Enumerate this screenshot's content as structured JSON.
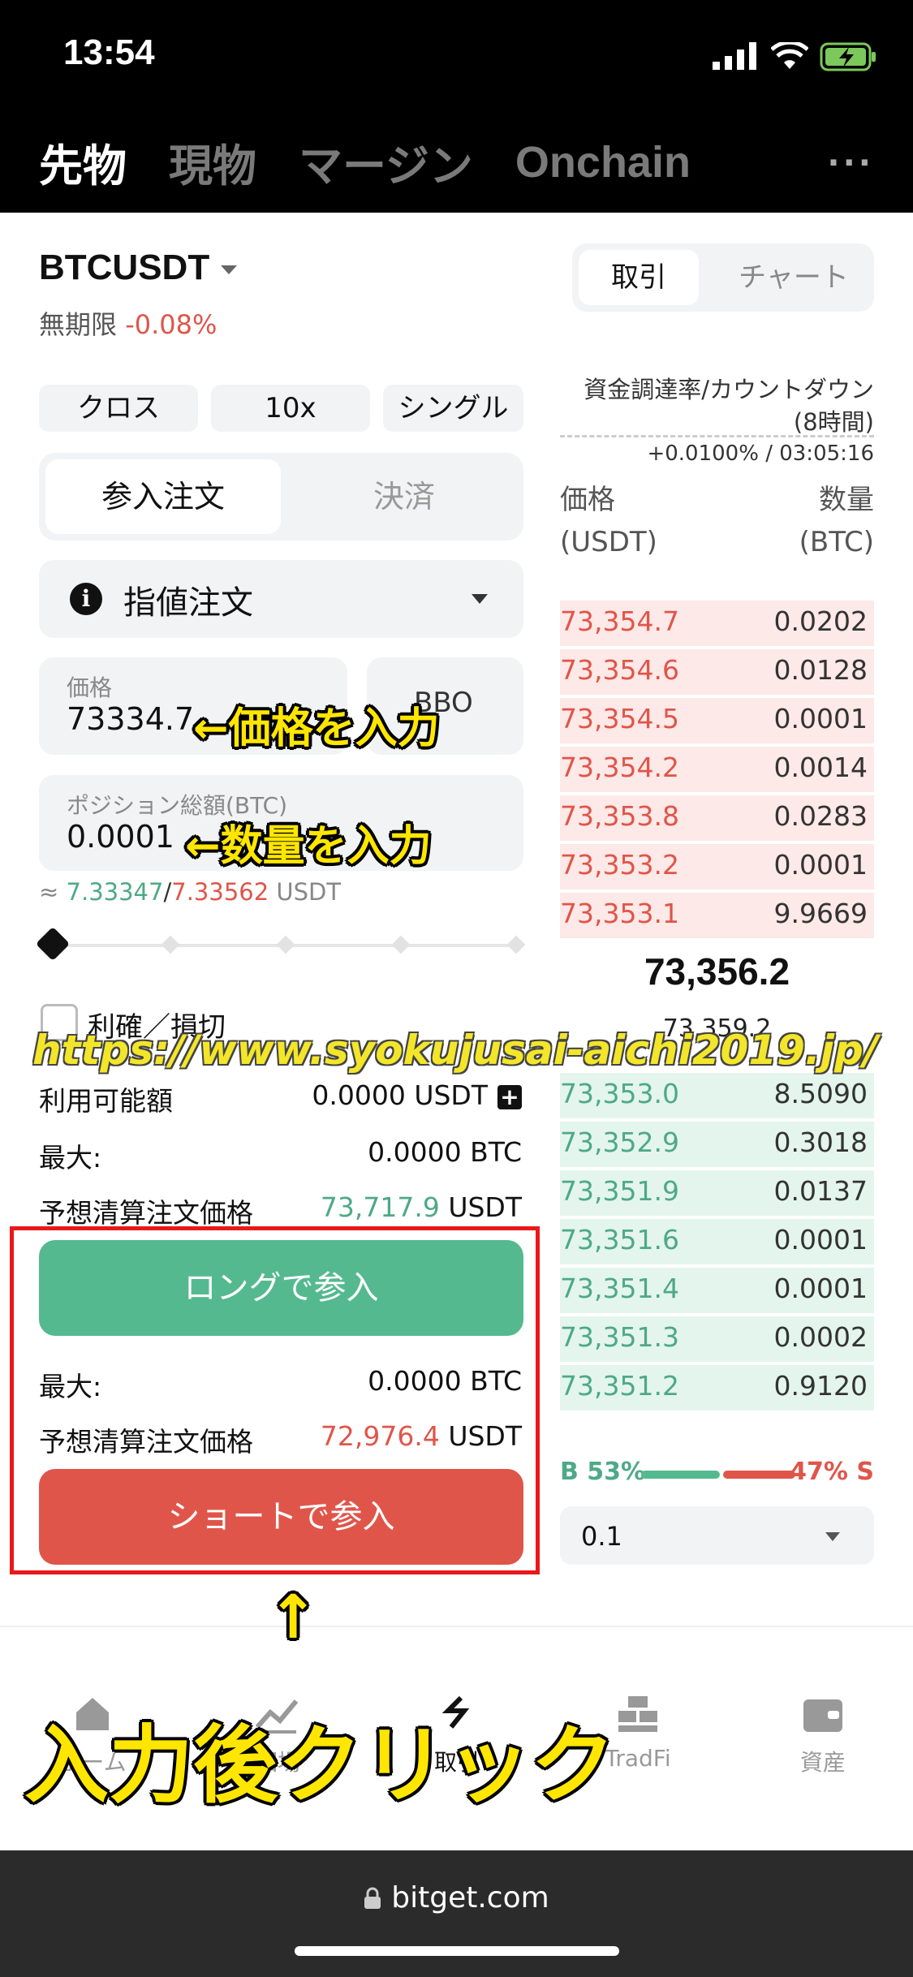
{
  "status": {
    "time": "13:54"
  },
  "top_tabs": [
    "先物",
    "現物",
    "マージン",
    "Onchain"
  ],
  "more": "···",
  "symbol": {
    "name": "BTCUSDT",
    "sub": "無期限",
    "change": "-0.08%"
  },
  "view_toggle": {
    "trade": "取引",
    "chart": "チャート"
  },
  "options": {
    "margin_mode": "クロス",
    "leverage": "10x",
    "position_mode": "シングル"
  },
  "order_tabs": {
    "open": "参入注文",
    "close": "決済"
  },
  "order_type": {
    "label": "指値注文",
    "info": "i"
  },
  "price_field": {
    "label": "価格",
    "value": "73334.7"
  },
  "bbo": "BBO",
  "size_field": {
    "label": "ポジション総額(BTC)",
    "value": "0.0001"
  },
  "approx": {
    "prefix": "≈ ",
    "v1": "7.33347",
    "sep": "/",
    "v2": "7.33562",
    "unit": " USDT"
  },
  "slider_level_percent": 0,
  "tpsl": "利確／損切",
  "available": {
    "label": "利用可能額",
    "value": "0.0000 USDT"
  },
  "long": {
    "max_label": "最大:",
    "max_value": "0.0000 BTC",
    "liq_label": "予想清算注文価格",
    "liq_value": "73,717.9",
    "liq_unit": " USDT",
    "button": "ロングで参入"
  },
  "short": {
    "max_label": "最大:",
    "max_value": "0.0000 BTC",
    "liq_label": "予想清算注文価格",
    "liq_value": "72,976.4",
    "liq_unit": " USDT",
    "button": "ショートで参入"
  },
  "funding": {
    "label1": "資金調達率/カウントダウン",
    "label2": "(8時間)",
    "value": "+0.0100% / 03:05:16"
  },
  "orderbook": {
    "price_header": [
      "価格",
      "(USDT)"
    ],
    "qty_header": [
      "数量",
      "(BTC)"
    ],
    "asks": [
      {
        "price": "73,354.7",
        "qty": "0.0202"
      },
      {
        "price": "73,354.6",
        "qty": "0.0128"
      },
      {
        "price": "73,354.5",
        "qty": "0.0001"
      },
      {
        "price": "73,354.2",
        "qty": "0.0014"
      },
      {
        "price": "73,353.8",
        "qty": "0.0283"
      },
      {
        "price": "73,353.2",
        "qty": "0.0001"
      },
      {
        "price": "73,353.1",
        "qty": "9.9669"
      }
    ],
    "last_price": "73,356.2",
    "mark_price": "73,359.2",
    "bids": [
      {
        "price": "73,353.0",
        "qty": "8.5090"
      },
      {
        "price": "73,352.9",
        "qty": "0.3018"
      },
      {
        "price": "73,351.9",
        "qty": "0.0137"
      },
      {
        "price": "73,351.6",
        "qty": "0.0001"
      },
      {
        "price": "73,351.4",
        "qty": "0.0001"
      },
      {
        "price": "73,351.3",
        "qty": "0.0002"
      },
      {
        "price": "73,351.2",
        "qty": "0.9120"
      }
    ],
    "buy_label": "B 53%",
    "sell_label": "47% S",
    "buy_percent": 53,
    "depth": "0.1"
  },
  "bottom_nav": [
    "ホーム",
    "相場",
    "取引",
    "TradFi",
    "資産"
  ],
  "browser": {
    "url": "bitget.com"
  },
  "annotations": {
    "price": "←価格を入力",
    "qty": "←数量を入力",
    "click": "入力後クリック",
    "arrow": "↑",
    "watermark": "https://www.syokujusai-aichi2019.jp/"
  },
  "colors": {
    "green": "#4ea987",
    "red": "#e0554a",
    "highlight": "#e8191b",
    "annotation": "#ffe600"
  }
}
